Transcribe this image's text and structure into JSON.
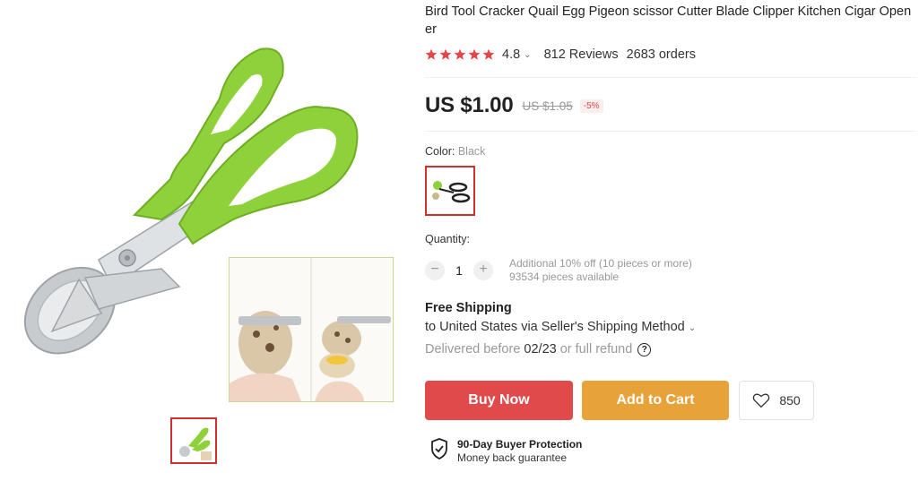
{
  "product": {
    "title": "Bird Tool Cracker Quail Egg Pigeon scissor Cutter Blade Clipper Kitchen Cigar Opener",
    "rating": "4.8",
    "reviews": "812 Reviews",
    "orders": "2683 orders",
    "stars": 5
  },
  "price": {
    "current": "US $1.00",
    "original": "US $1.05",
    "discount": "-5%"
  },
  "color": {
    "label": "Color:",
    "value": "Black"
  },
  "quantity": {
    "label": "Quantity:",
    "value": "1",
    "minus": "−",
    "plus": "+",
    "bulk_note": "Additional 10% off (10 pieces or more)",
    "available": "93534 pieces available"
  },
  "shipping": {
    "title": "Free Shipping",
    "method": "to United States via Seller's Shipping Method",
    "delivered_prefix": "Delivered before",
    "date": "02/23",
    "delivered_suffix": "or full refund"
  },
  "actions": {
    "buy_now": "Buy Now",
    "add_to_cart": "Add to Cart",
    "wishlist_count": "850"
  },
  "protection": {
    "title": "90-Day Buyer Protection",
    "subtitle": "Money back guarantee"
  },
  "colors": {
    "accent_red": "#e04a4a",
    "accent_orange": "#e8a23a",
    "star": "#e64545",
    "handle_green": "#8fd13a"
  }
}
